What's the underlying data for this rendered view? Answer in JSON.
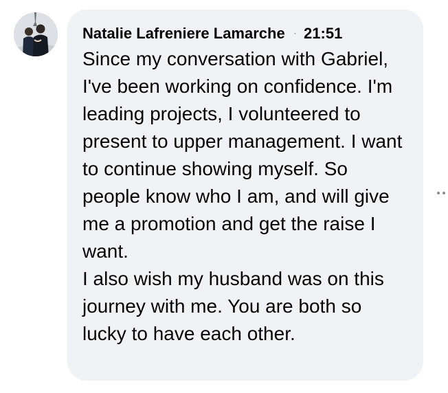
{
  "comment": {
    "author": "Natalie Lafreniere Lamarche",
    "separator": "·",
    "timestamp": "21:51",
    "paragraphs": [
      "Since my conversation with Gabriel, I've been working on confidence. I'm leading projects, I volunteered to present to upper management. I want to continue showing myself. So people know who I am, and will give me a promotion and get the raise I want.",
      "I also wish my husband was on this journey with me. You are both so lucky to have each other."
    ]
  },
  "icons": {
    "avatar": "profile-photo",
    "options": "more-options-dots"
  },
  "colors": {
    "bubble_background": "#f0f2f5",
    "text": "#050505",
    "muted": "#8a8d91"
  }
}
